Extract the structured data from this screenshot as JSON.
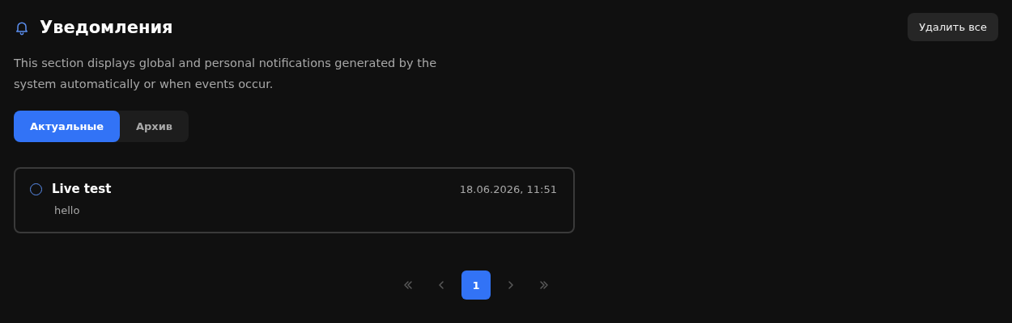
{
  "header": {
    "title": "Уведомления",
    "delete_all_button": "Удалить все"
  },
  "description": "This section displays global and personal notifications generated by the system automatically or when events occur.",
  "tabs": [
    {
      "label": "Актуальные",
      "selected": true
    },
    {
      "label": "Архив",
      "selected": false
    }
  ],
  "notifications": [
    {
      "title": "Live test",
      "time": "18.06.2026, 11:51",
      "body": "hello"
    }
  ],
  "pagination": [
    {
      "kind": "first"
    },
    {
      "kind": "prev"
    },
    {
      "kind": "page",
      "label": "1",
      "selected": true
    },
    {
      "kind": "next"
    },
    {
      "kind": "last"
    }
  ]
}
